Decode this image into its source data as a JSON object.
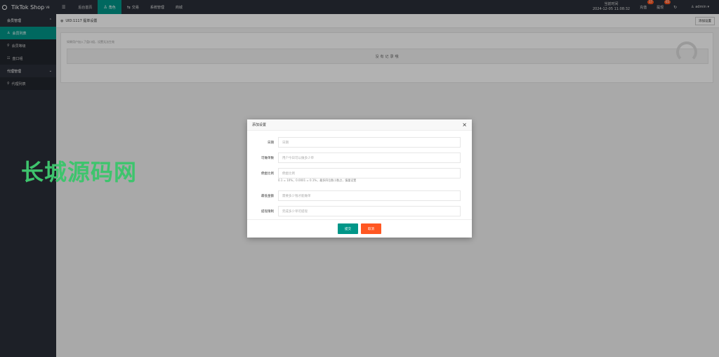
{
  "app": {
    "title": "TikTok Shop",
    "version": "V8"
  },
  "nav": [
    {
      "icon": "☰",
      "label": ""
    },
    {
      "icon": "",
      "label": "后台首页"
    },
    {
      "icon": "♙",
      "label": "角色"
    },
    {
      "icon": "⇆",
      "label": "交易"
    },
    {
      "icon": "",
      "label": "系统管理"
    },
    {
      "icon": "",
      "label": "商城"
    }
  ],
  "header": {
    "server_time_label": "当前时间",
    "server_time": "2024-12-05 11:08:32",
    "recharge_label": "充值",
    "recharge_count": "17",
    "withdraw_label": "提现",
    "withdraw_count": "65",
    "refresh_icon": "↻",
    "user": "admin"
  },
  "sidebar": {
    "group1": "会员管理",
    "group1_items": [
      "会员列表",
      "会员等级",
      "盘口组"
    ],
    "group2": "代理管理",
    "group2_items": [
      "代理列表"
    ]
  },
  "page": {
    "breadcrumb": "UID:1117 提单设置",
    "add_button": "添加设置",
    "hint": "如果用户加入了盘口组，设置无法生效",
    "empty": "没有记录哦"
  },
  "watermark": "长城源码网",
  "modal": {
    "title": "添加设置",
    "close": "×",
    "fields": [
      {
        "label": "日期",
        "placeholder": "日期"
      },
      {
        "label": "可做单数",
        "placeholder": "用户今日可以做多少单"
      },
      {
        "label": "佣金比例",
        "placeholder": "佣金比例"
      },
      {
        "label": "最低金额",
        "placeholder": "需要多少钱才能做单"
      },
      {
        "label": "提现限制",
        "placeholder": "完成多少单可提现"
      }
    ],
    "ratio_hint": "0.1 = 10%，0.0001 = 0.1%，最多四位数小数点，慎重设置",
    "submit": "提交",
    "cancel": "取消"
  }
}
